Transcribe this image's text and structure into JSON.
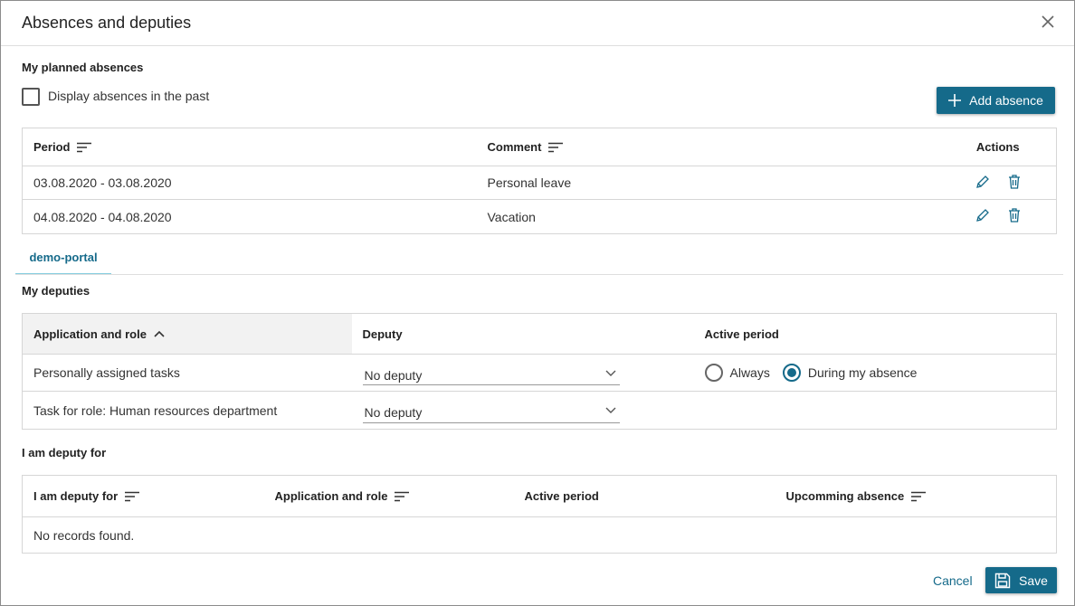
{
  "dialog": {
    "title": "Absences and deputies"
  },
  "planned": {
    "section_title": "My planned absences",
    "checkbox_label": "Display absences in the past",
    "add_button_label": "Add absence",
    "columns": {
      "period": "Period",
      "comment": "Comment",
      "actions": "Actions"
    },
    "rows": [
      {
        "period": "03.08.2020 - 03.08.2020",
        "comment": "Personal leave"
      },
      {
        "period": "04.08.2020 - 04.08.2020",
        "comment": "Vacation"
      }
    ]
  },
  "tabs": [
    {
      "label": "demo-portal",
      "active": true
    }
  ],
  "deputies": {
    "section_title": "My deputies",
    "columns": {
      "app_role": "Application and role",
      "deputy": "Deputy",
      "active_period": "Active period"
    },
    "rows": [
      {
        "app_role": "Personally assigned tasks",
        "deputy": "No deputy",
        "radio_always": "Always",
        "radio_during": "During my absence",
        "selected": "During my absence"
      },
      {
        "app_role": "Task for role: Human resources department",
        "deputy": "No deputy"
      }
    ]
  },
  "deputy_for": {
    "section_title": "I am deputy for",
    "columns": {
      "deputy_for": "I am deputy for",
      "app_role": "Application and role",
      "active_period": "Active period",
      "upcoming": "Upcomming absence"
    },
    "empty_text": "No records found."
  },
  "footer": {
    "cancel_label": "Cancel",
    "save_label": "Save"
  },
  "colors": {
    "accent": "#156a8a",
    "tab_underline": "#84cddf",
    "border": "#d6d6d6"
  },
  "icons": [
    "close-icon",
    "plus-icon",
    "sort-icon",
    "pencil-icon",
    "trash-icon",
    "chevron-up-icon",
    "chevron-down-icon",
    "save-icon"
  ]
}
